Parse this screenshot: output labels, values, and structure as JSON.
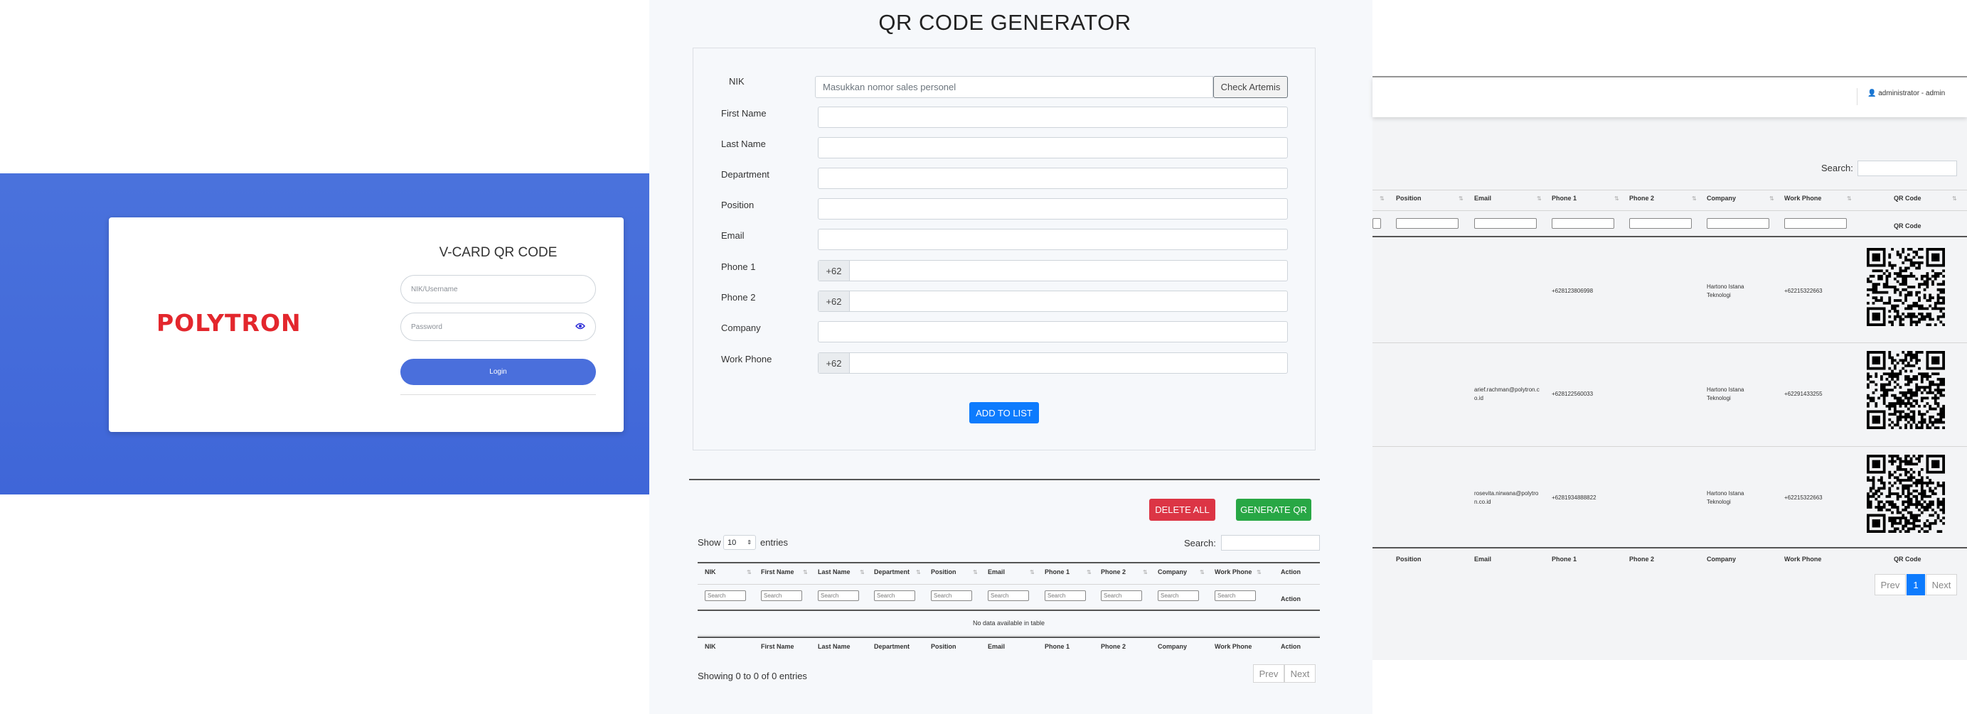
{
  "login": {
    "brand": "POLYTRON",
    "title": "V-CARD QR CODE",
    "username_placeholder": "NIK/Username",
    "password_placeholder": "Password",
    "login_label": "Login"
  },
  "generator": {
    "title": "QR CODE GENERATOR",
    "fields": {
      "nik": "NIK",
      "first_name": "First Name",
      "last_name": "Last Name",
      "department": "Department",
      "position": "Position",
      "email": "Email",
      "phone1": "Phone 1",
      "phone2": "Phone 2",
      "company": "Company",
      "work_phone": "Work Phone"
    },
    "nik_placeholder": "Masukkan nomor sales personel",
    "check_button": "Check Artemis",
    "phone_prefix": "+62",
    "add_button": "ADD TO LIST",
    "delete_all_button": "DELETE ALL",
    "generate_button": "GENERATE QR",
    "show_label": "Show",
    "entries_label": "entries",
    "page_length": "10",
    "search_label": "Search:",
    "columns": [
      "NIK",
      "First Name",
      "Last Name",
      "Department",
      "Position",
      "Email",
      "Phone 1",
      "Phone 2",
      "Company",
      "Work Phone",
      "Action"
    ],
    "column_search_placeholder": "Search",
    "action_label": "Action",
    "empty_message": "No data available in table",
    "info": "Showing 0 to 0 of 0 entries",
    "prev": "Prev",
    "next": "Next"
  },
  "admin": {
    "user_label": "administrator - admin",
    "search_label": "Search:",
    "columns": [
      "Position",
      "Email",
      "Phone 1",
      "Phone 2",
      "Company",
      "Work Phone",
      "QR Code"
    ],
    "qr_filter_label": "QR Code",
    "rows": [
      {
        "email": "",
        "phone1": "+628123806998",
        "phone2": "",
        "company": "Hartono Istana Teknologi",
        "work_phone": "+62215322663"
      },
      {
        "email": "arief.rachman@polytron.co.id",
        "phone1": "+628122560033",
        "phone2": "",
        "company": "Hartono Istana Teknologi",
        "work_phone": "+62291433255"
      },
      {
        "email": "rosevita.nirwana@polytron.co.id",
        "phone1": "+6281934888822",
        "phone2": "",
        "company": "Hartono Istana Teknologi",
        "work_phone": "+62215322663"
      }
    ],
    "prev": "Prev",
    "page": "1",
    "next": "Next"
  }
}
